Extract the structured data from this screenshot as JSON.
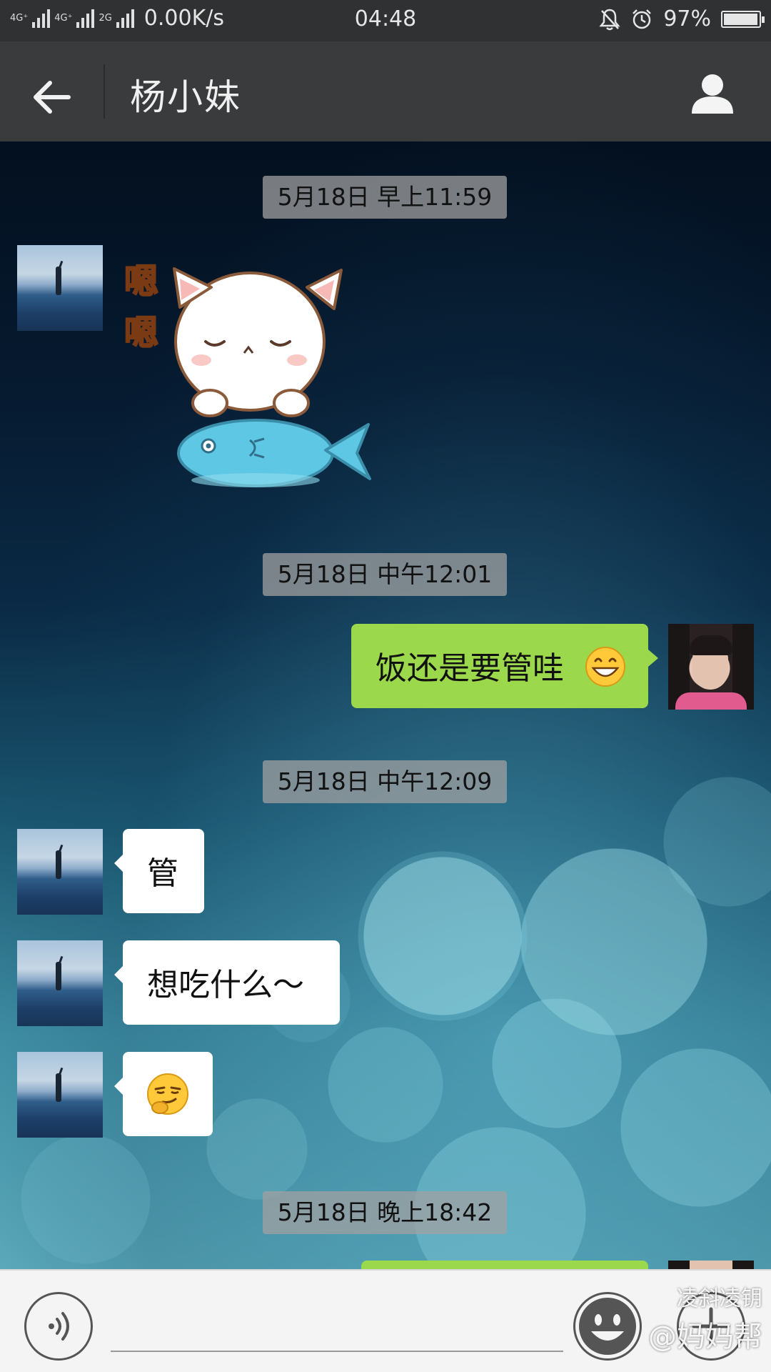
{
  "status_bar": {
    "network_labels": [
      "4G⁺",
      "4G⁺",
      "2G"
    ],
    "speed": "0.00K/s",
    "time": "04:48",
    "battery_percent_label": "97%",
    "battery_level": 0.97,
    "icons": [
      "mute-bell-icon",
      "alarm-clock-icon",
      "battery-icon"
    ]
  },
  "header": {
    "title": "杨小妹",
    "back_icon": "arrow-left-icon",
    "profile_icon": "person-icon"
  },
  "chat": {
    "timestamps": [
      "5月18日 早上11:59",
      "5月18日 中午12:01",
      "5月18日 中午12:09",
      "5月18日 晚上18:42"
    ],
    "sticker": {
      "caption_chars": [
        "嗯",
        "嗯"
      ]
    },
    "messages": [
      {
        "from": "me",
        "text": "饭还是要管哇",
        "emoji": "grin-emoji"
      },
      {
        "from": "contact",
        "text": "管"
      },
      {
        "from": "contact",
        "text": "想吃什么～"
      },
      {
        "from": "contact",
        "emoji": "smirk-thinking-emoji"
      }
    ]
  },
  "input_bar": {
    "placeholder": "",
    "icons": [
      "voice-icon",
      "emoji-icon",
      "plus-icon"
    ]
  },
  "watermark": {
    "line1": "凌斜凌钥",
    "line2": "@妈妈帮"
  },
  "colors": {
    "status_bar_bg": "#2f3132",
    "title_bar_bg": "#393b3c",
    "outgoing_bubble": "#9cd84b",
    "incoming_bubble": "#ffffff",
    "timestamp_pill": "#a0a0a0"
  }
}
